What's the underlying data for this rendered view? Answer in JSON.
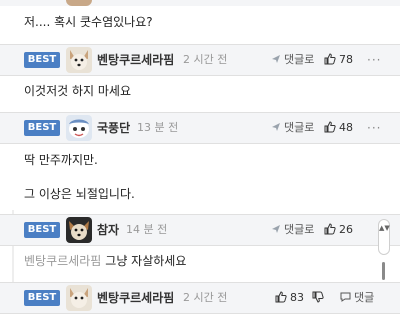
{
  "comments": [
    {
      "text": "저.... 혹시 쿳수염있나요?"
    },
    {
      "badge": "BEST",
      "nickname": "벤탕쿠르세라핌",
      "time": "2 시간 전",
      "reply_label": "댓글로",
      "likes": "78",
      "avatar_icon": "dog-avatar-icon",
      "text": "이것저것 하지 마세요"
    },
    {
      "badge": "BEST",
      "nickname": "국풍단",
      "time": "13 분 전",
      "reply_label": "댓글로",
      "likes": "48",
      "avatar_icon": "cartoon-avatar-icon",
      "text_lines": [
        "딱 만주까지만.",
        "그 이상은 뇌절입니다."
      ]
    },
    {
      "badge": "BEST",
      "nickname": "참자",
      "time": "14 분 전",
      "reply_label": "댓글로",
      "likes": "26",
      "avatar_icon": "dog-avatar-icon",
      "quote_nickname": "벤탕쿠르세라핌",
      "text": "그냥 자살하세요"
    },
    {
      "badge": "BEST",
      "nickname": "벤탕쿠르세라핌",
      "time": "2 시간 전",
      "likes": "83",
      "reply_label": "댓글",
      "avatar_icon": "dog-avatar-icon"
    }
  ],
  "more_label": "···",
  "scrollbar_arrows": "▲▼",
  "colors": {
    "badge": "#4b7fc4",
    "header_bg": "#f4f5f7"
  }
}
